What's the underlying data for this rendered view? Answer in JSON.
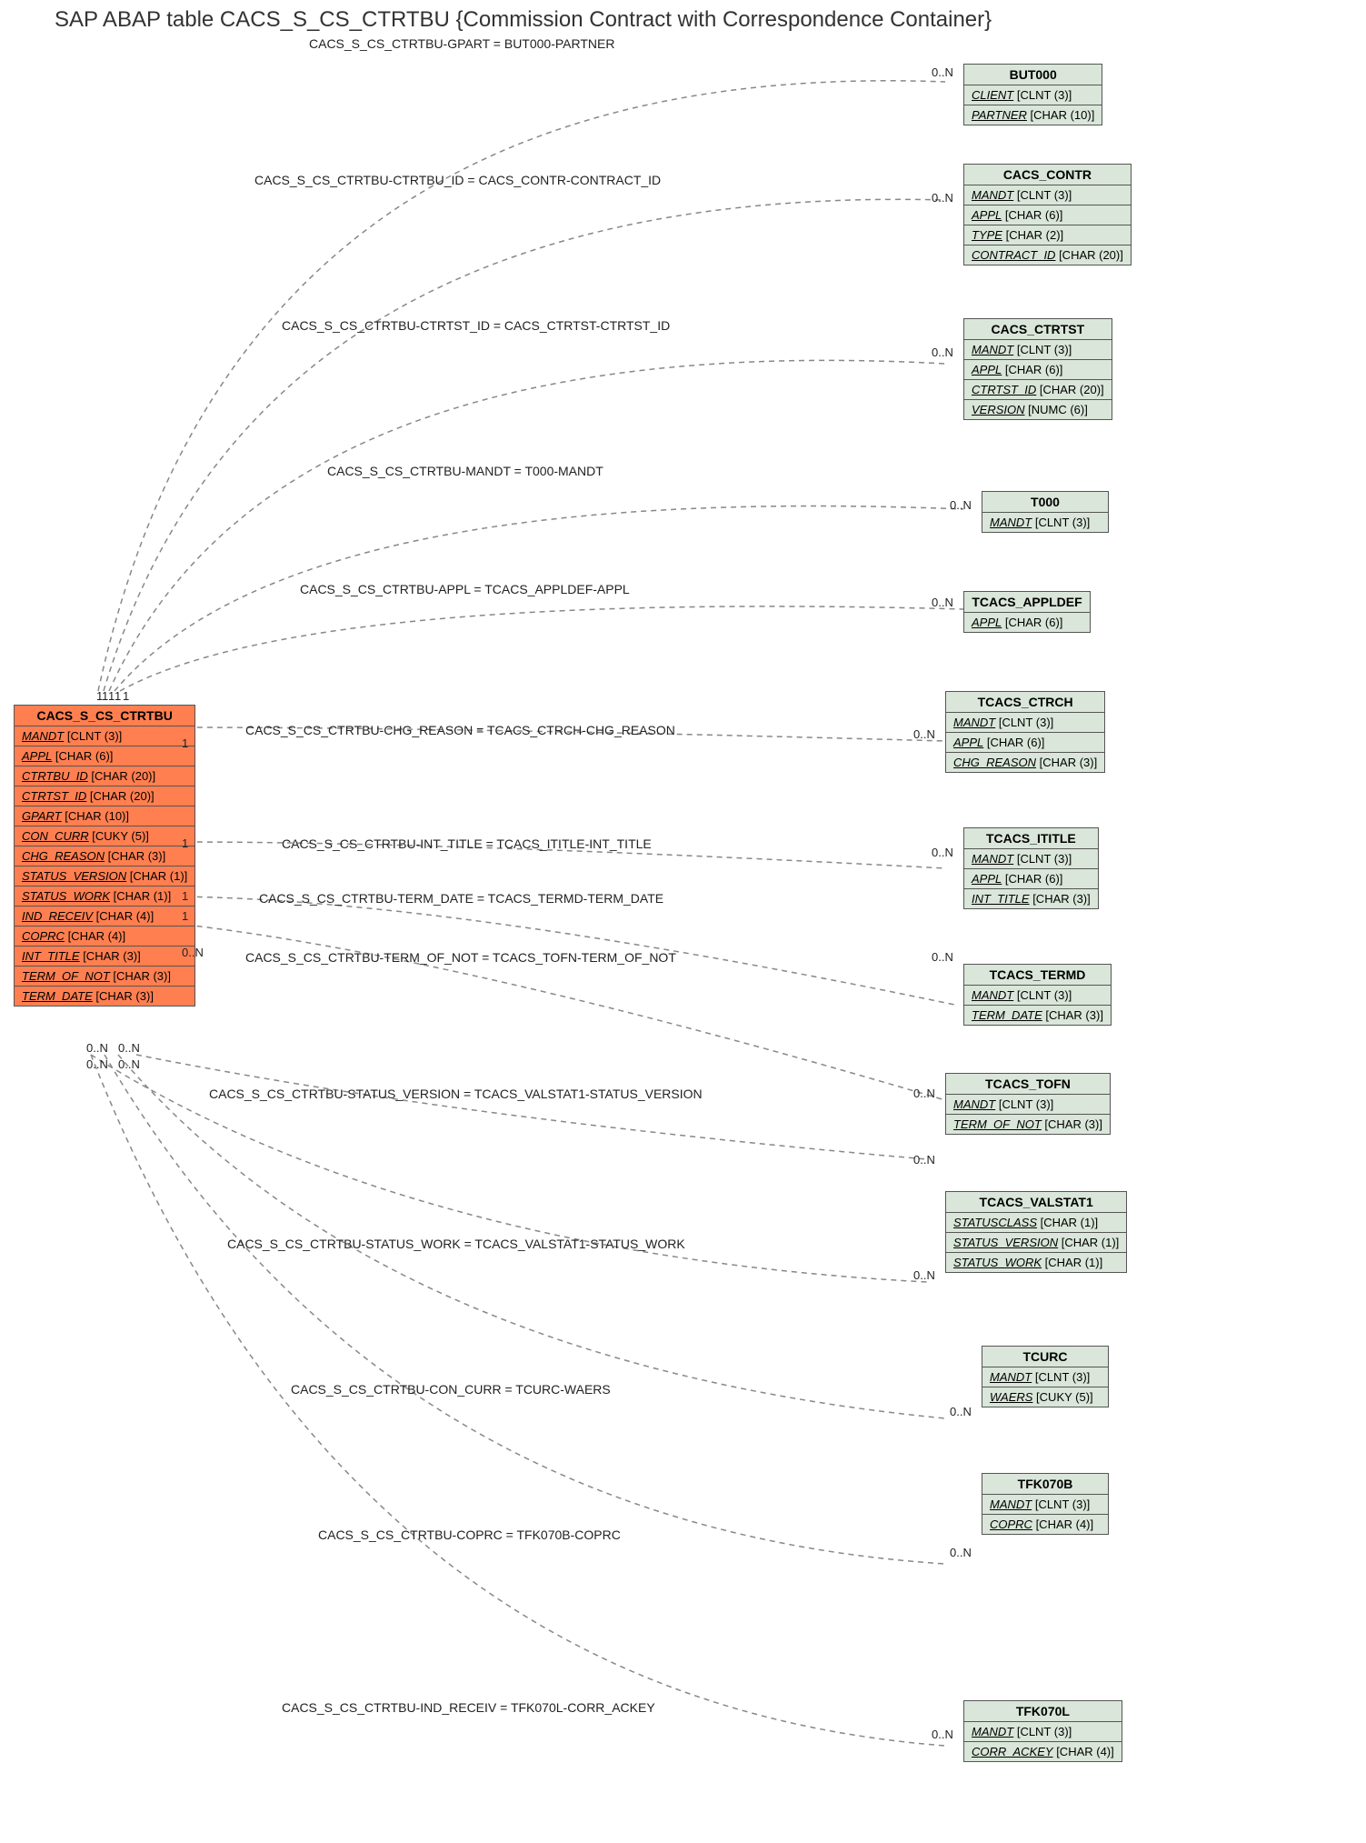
{
  "title": "SAP ABAP table CACS_S_CS_CTRTBU {Commission Contract with Correspondence Container}",
  "main_entity": {
    "name": "CACS_S_CS_CTRTBU",
    "fields": [
      {
        "name": "MANDT",
        "type": "[CLNT (3)]"
      },
      {
        "name": "APPL",
        "type": "[CHAR (6)]"
      },
      {
        "name": "CTRTBU_ID",
        "type": "[CHAR (20)]"
      },
      {
        "name": "CTRTST_ID",
        "type": "[CHAR (20)]"
      },
      {
        "name": "GPART",
        "type": "[CHAR (10)]"
      },
      {
        "name": "CON_CURR",
        "type": "[CUKY (5)]"
      },
      {
        "name": "CHG_REASON",
        "type": "[CHAR (3)]"
      },
      {
        "name": "STATUS_VERSION",
        "type": "[CHAR (1)]"
      },
      {
        "name": "STATUS_WORK",
        "type": "[CHAR (1)]"
      },
      {
        "name": "IND_RECEIV",
        "type": "[CHAR (4)]"
      },
      {
        "name": "COPRC",
        "type": "[CHAR (4)]"
      },
      {
        "name": "INT_TITLE",
        "type": "[CHAR (3)]"
      },
      {
        "name": "TERM_OF_NOT",
        "type": "[CHAR (3)]"
      },
      {
        "name": "TERM_DATE",
        "type": "[CHAR (3)]"
      }
    ]
  },
  "related_entities": [
    {
      "name": "BUT000",
      "fields": [
        {
          "name": "CLIENT",
          "type": "[CLNT (3)]"
        },
        {
          "name": "PARTNER",
          "type": "[CHAR (10)]"
        }
      ]
    },
    {
      "name": "CACS_CONTR",
      "fields": [
        {
          "name": "MANDT",
          "type": "[CLNT (3)]"
        },
        {
          "name": "APPL",
          "type": "[CHAR (6)]"
        },
        {
          "name": "TYPE",
          "type": "[CHAR (2)]"
        },
        {
          "name": "CONTRACT_ID",
          "type": "[CHAR (20)]"
        }
      ]
    },
    {
      "name": "CACS_CTRTST",
      "fields": [
        {
          "name": "MANDT",
          "type": "[CLNT (3)]"
        },
        {
          "name": "APPL",
          "type": "[CHAR (6)]"
        },
        {
          "name": "CTRTST_ID",
          "type": "[CHAR (20)]"
        },
        {
          "name": "VERSION",
          "type": "[NUMC (6)]"
        }
      ]
    },
    {
      "name": "T000",
      "fields": [
        {
          "name": "MANDT",
          "type": "[CLNT (3)]"
        }
      ]
    },
    {
      "name": "TCACS_APPLDEF",
      "fields": [
        {
          "name": "APPL",
          "type": "[CHAR (6)]"
        }
      ]
    },
    {
      "name": "TCACS_CTRCH",
      "fields": [
        {
          "name": "MANDT",
          "type": "[CLNT (3)]"
        },
        {
          "name": "APPL",
          "type": "[CHAR (6)]"
        },
        {
          "name": "CHG_REASON",
          "type": "[CHAR (3)]"
        }
      ]
    },
    {
      "name": "TCACS_ITITLE",
      "fields": [
        {
          "name": "MANDT",
          "type": "[CLNT (3)]"
        },
        {
          "name": "APPL",
          "type": "[CHAR (6)]"
        },
        {
          "name": "INT_TITLE",
          "type": "[CHAR (3)]"
        }
      ]
    },
    {
      "name": "TCACS_TERMD",
      "fields": [
        {
          "name": "MANDT",
          "type": "[CLNT (3)]"
        },
        {
          "name": "TERM_DATE",
          "type": "[CHAR (3)]"
        }
      ]
    },
    {
      "name": "TCACS_TOFN",
      "fields": [
        {
          "name": "MANDT",
          "type": "[CLNT (3)]"
        },
        {
          "name": "TERM_OF_NOT",
          "type": "[CHAR (3)]"
        }
      ]
    },
    {
      "name": "TCACS_VALSTAT1",
      "fields": [
        {
          "name": "STATUSCLASS",
          "type": "[CHAR (1)]"
        },
        {
          "name": "STATUS_VERSION",
          "type": "[CHAR (1)]"
        },
        {
          "name": "STATUS_WORK",
          "type": "[CHAR (1)]"
        }
      ]
    },
    {
      "name": "TCURC",
      "fields": [
        {
          "name": "MANDT",
          "type": "[CLNT (3)]"
        },
        {
          "name": "WAERS",
          "type": "[CUKY (5)]"
        }
      ]
    },
    {
      "name": "TFK070B",
      "fields": [
        {
          "name": "MANDT",
          "type": "[CLNT (3)]"
        },
        {
          "name": "COPRC",
          "type": "[CHAR (4)]"
        }
      ]
    },
    {
      "name": "TFK070L",
      "fields": [
        {
          "name": "MANDT",
          "type": "[CLNT (3)]"
        },
        {
          "name": "CORR_ACKEY",
          "type": "[CHAR (4)]"
        }
      ]
    }
  ],
  "relations": [
    {
      "label": "CACS_S_CS_CTRTBU-GPART = BUT000-PARTNER",
      "card_src": "1",
      "card_dst": "0..N"
    },
    {
      "label": "CACS_S_CS_CTRTBU-CTRTBU_ID = CACS_CONTR-CONTRACT_ID",
      "card_src": "1",
      "card_dst": "0..N"
    },
    {
      "label": "CACS_S_CS_CTRTBU-CTRTST_ID = CACS_CTRTST-CTRTST_ID",
      "card_src": "1",
      "card_dst": "0..N"
    },
    {
      "label": "CACS_S_CS_CTRTBU-MANDT = T000-MANDT",
      "card_src": "1",
      "card_dst": "0..N"
    },
    {
      "label": "CACS_S_CS_CTRTBU-APPL = TCACS_APPLDEF-APPL",
      "card_src": "1",
      "card_dst": "0..N"
    },
    {
      "label": "CACS_S_CS_CTRTBU-CHG_REASON = TCACS_CTRCH-CHG_REASON",
      "card_src": "1",
      "card_dst": "0..N"
    },
    {
      "label": "CACS_S_CS_CTRTBU-INT_TITLE = TCACS_ITITLE-INT_TITLE",
      "card_src": "1",
      "card_dst": "0..N"
    },
    {
      "label": "CACS_S_CS_CTRTBU-TERM_DATE = TCACS_TERMD-TERM_DATE",
      "card_src": "1",
      "card_dst": "0..N"
    },
    {
      "label": "CACS_S_CS_CTRTBU-TERM_OF_NOT = TCACS_TOFN-TERM_OF_NOT",
      "card_src": "1",
      "card_dst": "0..N"
    },
    {
      "label": "CACS_S_CS_CTRTBU-STATUS_VERSION = TCACS_VALSTAT1-STATUS_VERSION",
      "card_src": "0..N",
      "card_dst": "0..N"
    },
    {
      "label": "CACS_S_CS_CTRTBU-STATUS_WORK = TCACS_VALSTAT1-STATUS_WORK",
      "card_src": "0..N",
      "card_dst": "0..N"
    },
    {
      "label": "CACS_S_CS_CTRTBU-CON_CURR = TCURC-WAERS",
      "card_src": "0..N",
      "card_dst": "0..N"
    },
    {
      "label": "CACS_S_CS_CTRTBU-COPRC = TFK070B-COPRC",
      "card_src": "0..N",
      "card_dst": "0..N"
    },
    {
      "label": "CACS_S_CS_CTRTBU-IND_RECEIV = TFK070L-CORR_ACKEY",
      "card_src": "0..N",
      "card_dst": "0..N"
    }
  ]
}
